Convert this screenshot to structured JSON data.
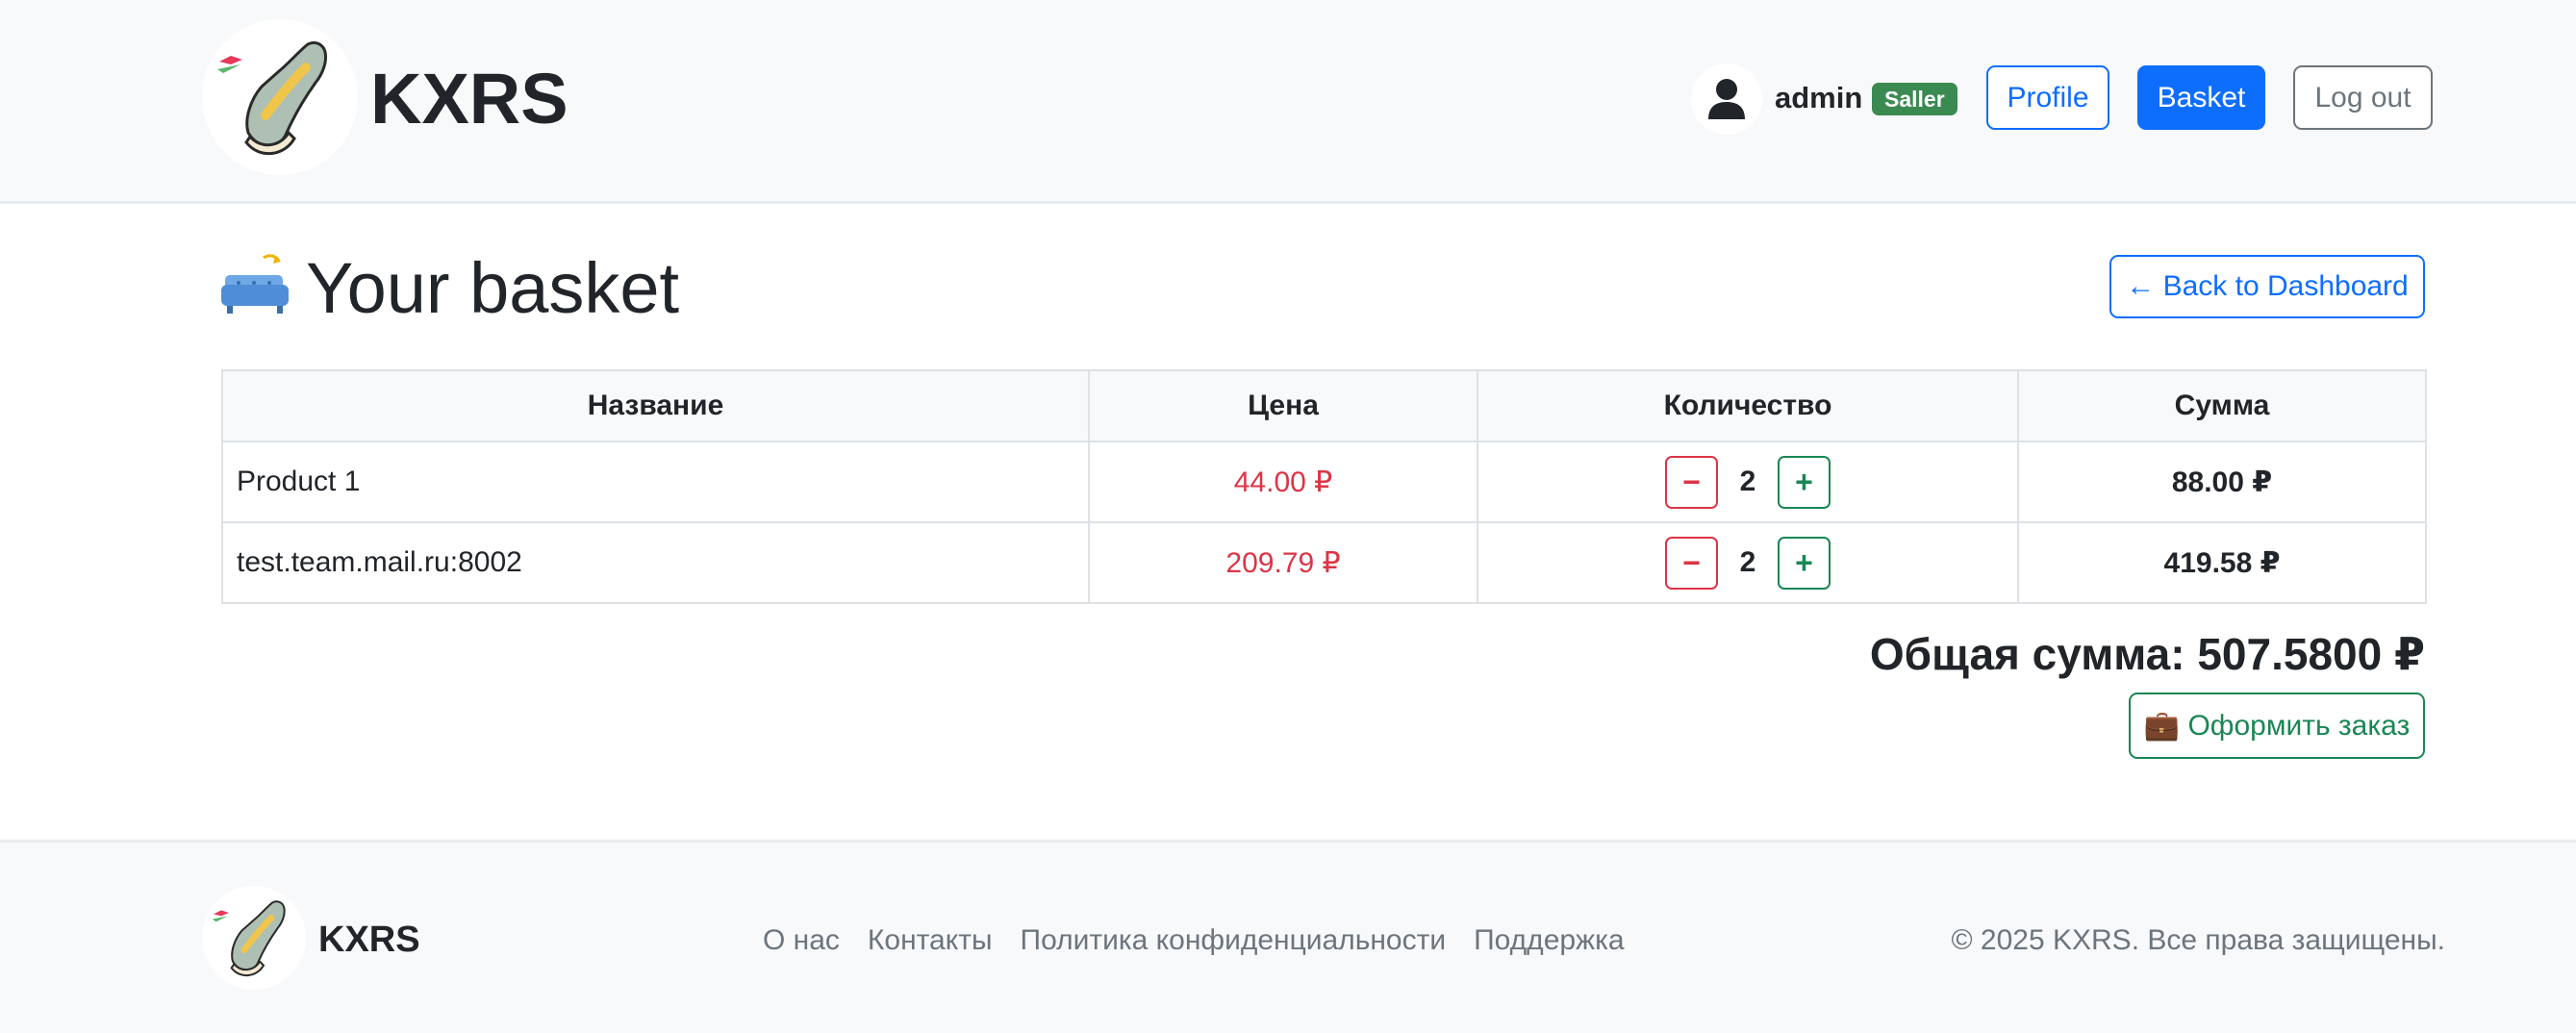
{
  "header": {
    "brand": "KXRS",
    "username": "admin",
    "role_badge": "Saller",
    "nav": {
      "profile": "Profile",
      "basket": "Basket",
      "logout": "Log out"
    }
  },
  "main": {
    "title": "Your basket",
    "back_button": "← Back to Dashboard",
    "table": {
      "columns": [
        "Название",
        "Цена",
        "Количество",
        "Сумма"
      ],
      "rows": [
        {
          "name": "Product 1",
          "price": "44.00 ₽",
          "quantity": "2",
          "sum": "88.00 ₽"
        },
        {
          "name": "test.team.mail.ru:8002",
          "price": "209.79 ₽",
          "quantity": "2",
          "sum": "419.58 ₽"
        }
      ],
      "decrement_label": "−",
      "increment_label": "+"
    },
    "total": "Общая сумма: 507.5800 ₽",
    "checkout_button": "💼 Оформить заказ"
  },
  "footer": {
    "brand": "KXRS",
    "links": [
      "О нас",
      "Контакты",
      "Политика конфиденциальности",
      "Поддержка"
    ],
    "copyright": "© 2025 KXRS. Все права защищены."
  },
  "colors": {
    "primary": "#0d6efd",
    "danger": "#dc3545",
    "success": "#198754",
    "badge": "#3b8a52",
    "secondary": "#6c757d"
  },
  "icons": {
    "logo": "sneaker-logo-icon",
    "user": "user-avatar-icon",
    "heading": "sofa-icon",
    "checkout": "briefcase-icon"
  }
}
